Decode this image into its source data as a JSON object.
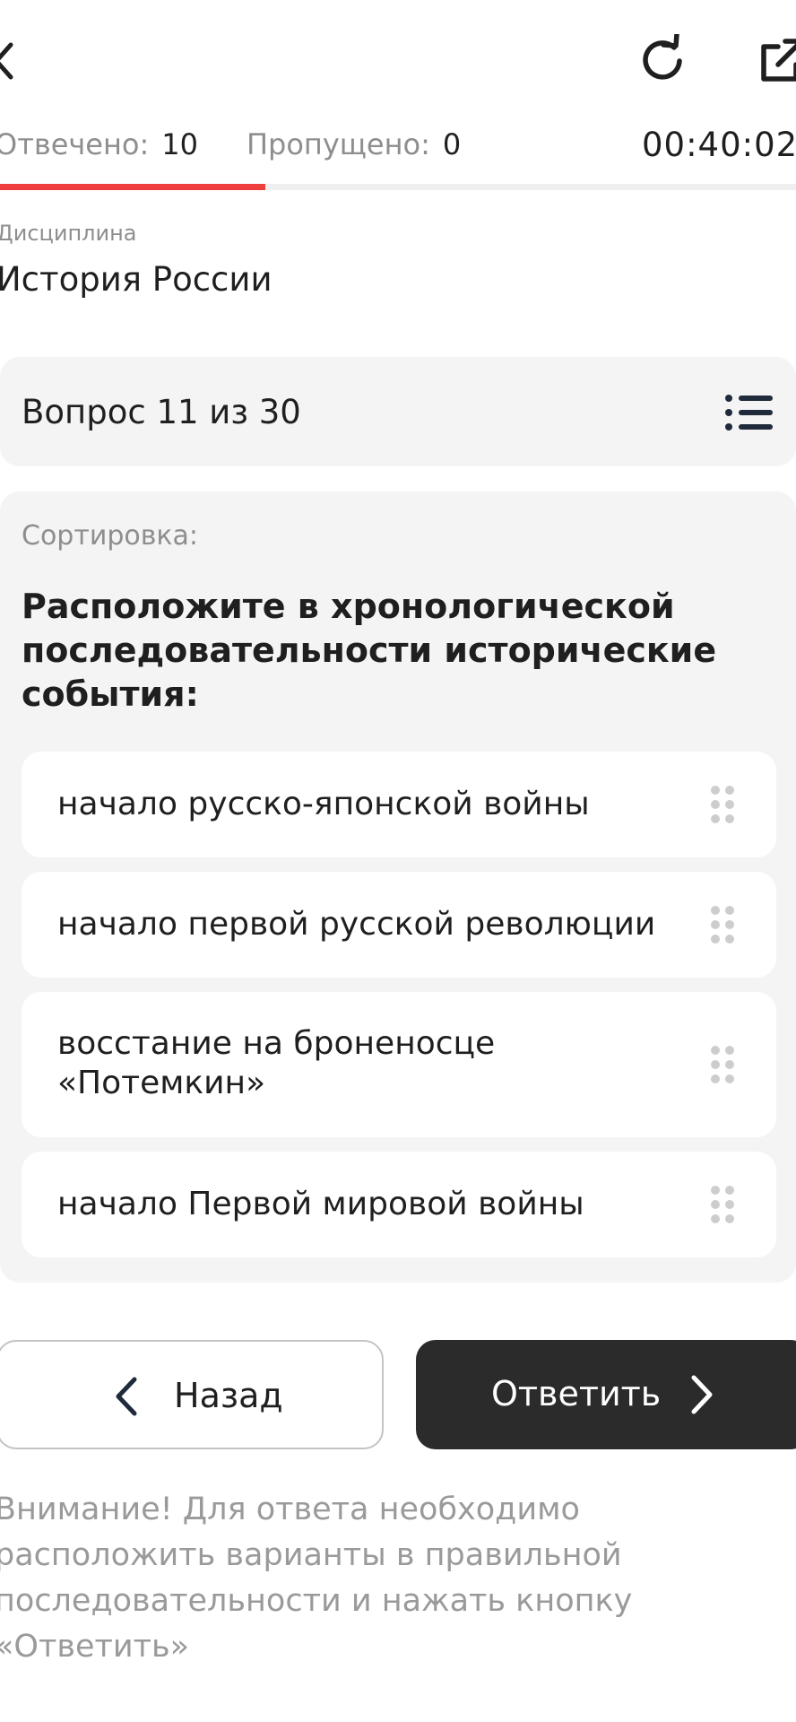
{
  "header": {
    "back_icon": "chevron-left-icon",
    "refresh_icon": "refresh-icon",
    "share_icon": "external-link-icon",
    "answered_label": "Отвечено:",
    "answered_value": "10",
    "skipped_label": "Пропущено:",
    "skipped_value": "0",
    "timer": "00:40:02",
    "progress_fraction": 0.3333,
    "progress_color": "#ef3e3e"
  },
  "discipline": {
    "label": "Дисциплина",
    "value": "История России"
  },
  "question_header": {
    "title": "Вопрос 11 из 30",
    "list_icon": "list-icon"
  },
  "question": {
    "type_label": "Сортировка:",
    "text": "Расположите в хронологической последовательности исторические события:",
    "options": [
      {
        "label": "начало русско-японской войны"
      },
      {
        "label": "начало первой русской революции"
      },
      {
        "label": "восстание на броненосце «Потемкин»"
      },
      {
        "label": "начало Первой мировой войны"
      }
    ]
  },
  "actions": {
    "back_label": "Назад",
    "answer_label": "Ответить",
    "answer_bg": "#2b2b2b"
  },
  "notice": "Внимание! Для ответа необходимо расположить варианты в правильной последовательности и нажать кнопку «Ответить»"
}
